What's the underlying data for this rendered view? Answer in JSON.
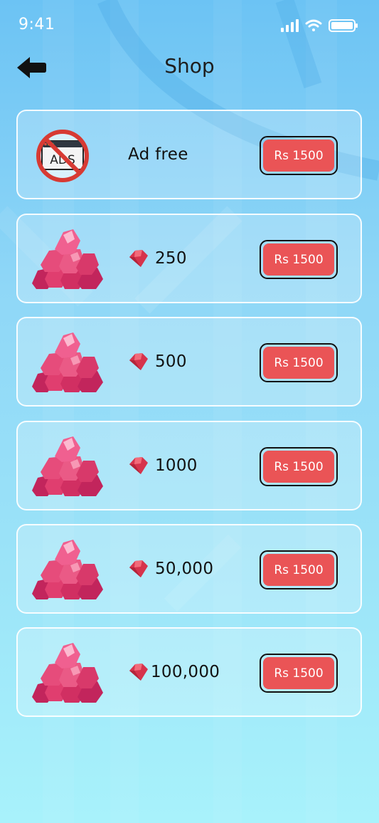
{
  "status_bar": {
    "time": "9:41"
  },
  "header": {
    "title": "Shop",
    "back_icon": "arrow-left-icon"
  },
  "items": [
    {
      "label": "Ad free",
      "price": "Rs 1500",
      "icon": "no-ads-icon"
    },
    {
      "label": "250",
      "price": "Rs 1500",
      "icon": "gem-pile-icon"
    },
    {
      "label": "500",
      "price": "Rs 1500",
      "icon": "gem-pile-icon"
    },
    {
      "label": "1000",
      "price": "Rs 1500",
      "icon": "gem-pile-icon"
    },
    {
      "label": "50,000",
      "price": "Rs 1500",
      "icon": "gem-pile-icon"
    },
    {
      "label": "100,000",
      "price": "Rs 1500",
      "icon": "gem-pile-icon"
    }
  ],
  "no_ads_text": "ADS",
  "colors": {
    "button": "#ea5456",
    "gem": "#d93a6a"
  }
}
